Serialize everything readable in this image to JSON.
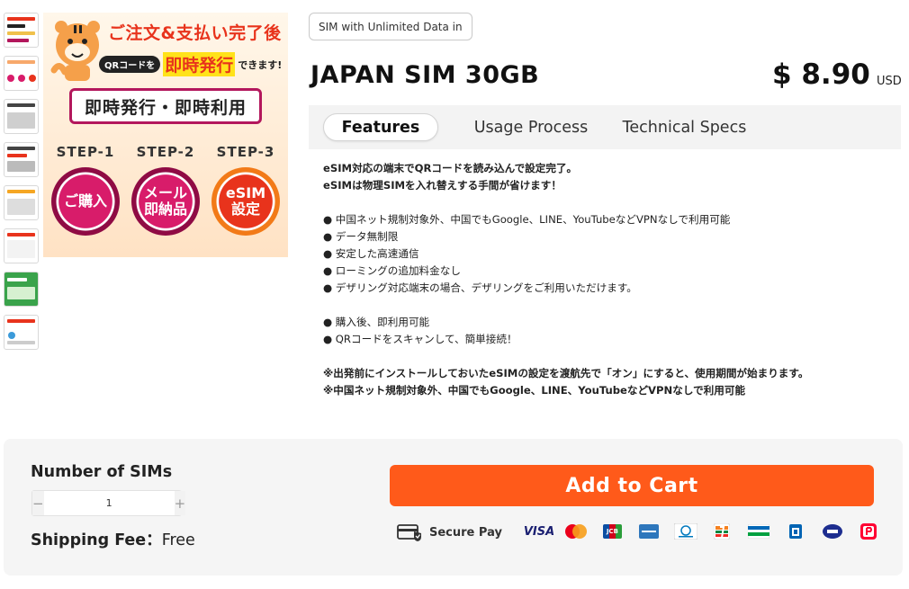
{
  "gallery": {
    "thumbnails": [
      "thumb-1",
      "thumb-2",
      "thumb-3",
      "thumb-4",
      "thumb-5",
      "thumb-6",
      "thumb-7",
      "thumb-8"
    ],
    "main_image": {
      "headline": "ご注文&支払い完了後",
      "qr_label": "QRコードを",
      "qr_highlight": "即時発行",
      "qr_suffix": "できます!",
      "box_text": "即時発行・即時利用",
      "steps": [
        {
          "label": "STEP-1",
          "circle_lines": [
            "ご購入"
          ]
        },
        {
          "label": "STEP-2",
          "circle_lines": [
            "メール",
            "即納品"
          ]
        },
        {
          "label": "STEP-3",
          "circle_lines": [
            "eSIM",
            "設定"
          ]
        }
      ]
    }
  },
  "product": {
    "tag": "SIM with Unlimited Data in",
    "title": "JAPAN SIM 30GB",
    "price": "$ 8.90",
    "currency": "USD"
  },
  "tabs": [
    {
      "label": "Features",
      "active": true
    },
    {
      "label": "Usage Process",
      "active": false
    },
    {
      "label": "Technical Specs",
      "active": false
    }
  ],
  "features": {
    "intro": [
      "eSIM対応の端末でQRコードを読み込んで設定完了。",
      "eSIMは物理SIMを入れ替えする手間が省けます！"
    ],
    "bullets_1": [
      "● 中国ネット規制対象外、中国でもGoogle、LINE、YouTubeなどVPNなしで利用可能",
      "● データ無制限",
      "● 安定した高速通信",
      "● ローミングの追加料金なし",
      "● デザリング対応端末の場合、デザリングをご利用いただけます。"
    ],
    "bullets_2": [
      "● 購入後、即利用可能",
      "● QRコードをスキャンして、簡単接続！"
    ],
    "notes": [
      "※出発前にインストールしておいたeSIMの設定を渡航先で「オン」にすると、使用期間が始まります。",
      "※中国ネット規制対象外、中国でもGoogle、LINE、YouTubeなどVPNなしで利用可能"
    ]
  },
  "purchase": {
    "qty_label": "Number of SIMs",
    "qty_minus": "−",
    "qty_value": "1",
    "qty_plus": "+",
    "shipping_key": "Shipping Fee：",
    "shipping_value": "Free",
    "cart_button": "Add to Cart",
    "secure_label": "Secure Pay",
    "payment_icons": [
      "visa-icon",
      "mastercard-icon",
      "jcb-icon",
      "amex-icon",
      "diners-icon",
      "seven-eleven-icon",
      "familymart-icon",
      "lawson-icon",
      "ministop-icon",
      "paypay-icon"
    ],
    "visa_text": "VISA",
    "jcb_text": "JCB"
  },
  "colors": {
    "accent": "#ff5a1a",
    "magenta": "#d81c6a",
    "red": "#e8331c"
  }
}
